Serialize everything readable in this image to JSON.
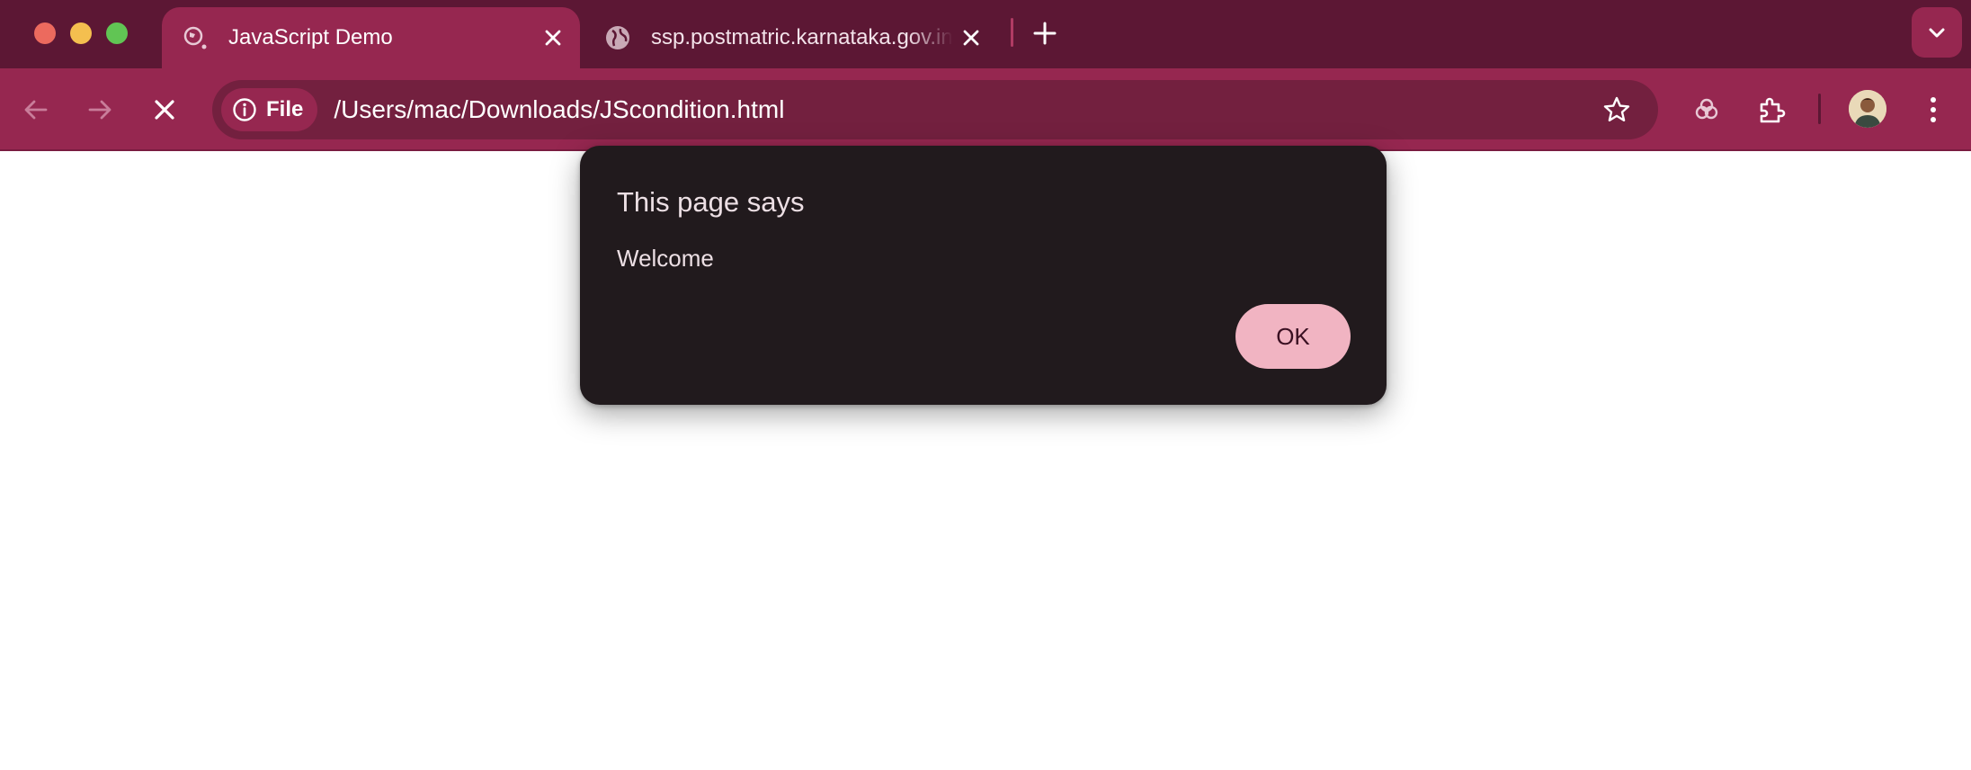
{
  "window": {
    "controls": [
      "close",
      "minimize",
      "maximize"
    ]
  },
  "tabs": [
    {
      "title": "JavaScript Demo",
      "active": true,
      "favicon": "loading-globe-icon"
    },
    {
      "title": "ssp.postmatric.karnataka.gov.in",
      "active": false,
      "favicon": "globe-icon"
    }
  ],
  "toolbar": {
    "security_chip": "File",
    "url": "/Users/mac/Downloads/JScondition.html"
  },
  "dialog": {
    "title": "This page says",
    "message": "Welcome",
    "ok_label": "OK"
  },
  "colors": {
    "tabstrip": "#5c1734",
    "toolbar": "#962750",
    "omnibox": "#73203f",
    "dialog_bg": "#211a1d",
    "ok_button": "#f1b4c2"
  }
}
